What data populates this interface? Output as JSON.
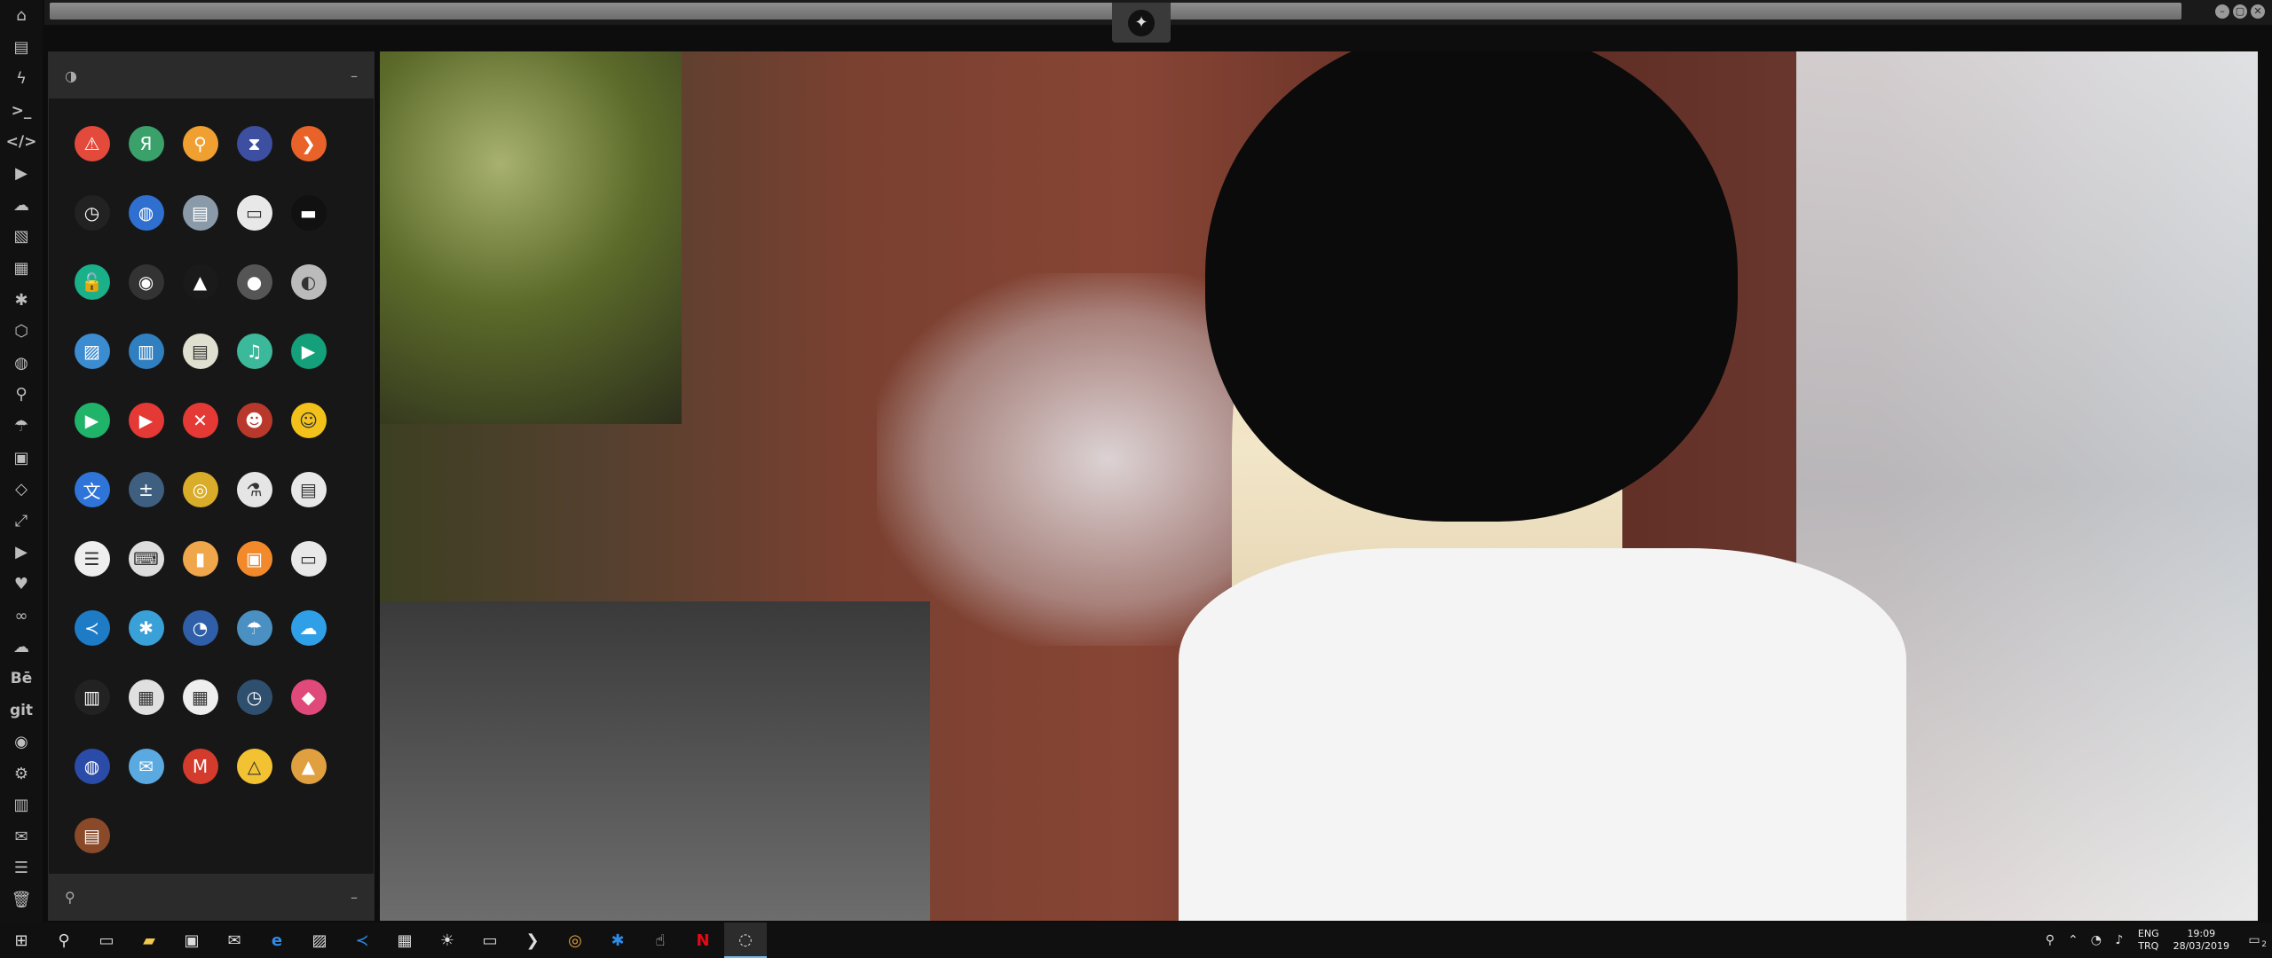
{
  "leftbar": {
    "icons": [
      "home-icon",
      "document-icon",
      "lightning-icon",
      "terminal-icon",
      "code-icon",
      "play-icon",
      "cloud-icon",
      "image-icon",
      "newspaper-icon",
      "gear-icon",
      "hexagon-icon",
      "globe-icon",
      "search-icon",
      "umbrella-icon",
      "contact-icon",
      "tag-icon",
      "expand-icon",
      "youtube-icon",
      "heart-icon",
      "link-icon",
      "cloud-upload-icon",
      "behance-icon",
      "git-icon",
      "github-icon",
      "bicycle-icon",
      "map-icon",
      "mail-icon",
      "list-icon",
      "trash-icon"
    ],
    "glyphs": [
      "⌂",
      "▤",
      "ϟ",
      ">_",
      "</>",
      "▶",
      "☁",
      "▧",
      "▦",
      "✱",
      "⬡",
      "◍",
      "⚲",
      "☂",
      "▣",
      "◇",
      "⤢",
      "▶",
      "♥",
      "∞",
      "☁",
      "Bē",
      "git",
      "◉",
      "⚙",
      "▥",
      "✉",
      "☰",
      "🗑"
    ]
  },
  "topbar": {
    "logo_glyph": "✦",
    "controls": [
      "–",
      "▢",
      "✕"
    ]
  },
  "panel": {
    "header_left_icon": "◑",
    "header_right_icon": "–",
    "footer_left_icon": "⚲",
    "footer_right_icon": "–",
    "apps": [
      {
        "name": "warning-app-icon",
        "glyph": "⚠",
        "color": "#e34a3b"
      },
      {
        "name": "yandex-app-icon",
        "glyph": "Я",
        "color": "#3aa16a"
      },
      {
        "name": "search-app-icon",
        "glyph": "⚲",
        "color": "#f0a030"
      },
      {
        "name": "hourglass-app-icon",
        "glyph": "⧗",
        "color": "#3c4fa0"
      },
      {
        "name": "arrow-app-icon",
        "glyph": "❯",
        "color": "#e8622a"
      },
      {
        "name": "clock-app-icon",
        "glyph": "◷",
        "color": "#222222"
      },
      {
        "name": "globe-app-icon",
        "glyph": "◍",
        "color": "#2f6fd0"
      },
      {
        "name": "server-app-icon",
        "glyph": "▤",
        "color": "#8a9aa8"
      },
      {
        "name": "window-app-icon",
        "glyph": "▭",
        "color": "#e8e8e8"
      },
      {
        "name": "hat-app-icon",
        "glyph": "▬",
        "color": "#111111"
      },
      {
        "name": "unlock-app-icon",
        "glyph": "🔓",
        "color": "#1ab08a"
      },
      {
        "name": "github-app-icon",
        "glyph": "◉",
        "color": "#333333"
      },
      {
        "name": "startrek-app-icon",
        "glyph": "▲",
        "color": "#1a1a1a"
      },
      {
        "name": "deathstar-app-icon",
        "glyph": "●",
        "color": "#555555"
      },
      {
        "name": "moon-app-icon",
        "glyph": "◐",
        "color": "#bbbbbb"
      },
      {
        "name": "photos-app-icon",
        "glyph": "▨",
        "color": "#3b8cd0"
      },
      {
        "name": "books-app-icon",
        "glyph": "▥",
        "color": "#2f7fc1"
      },
      {
        "name": "notes-app-icon",
        "glyph": "▤",
        "color": "#e0e0d0"
      },
      {
        "name": "music-app-icon",
        "glyph": "♫",
        "color": "#3cb89a"
      },
      {
        "name": "video-app-icon",
        "glyph": "▶",
        "color": "#13a07a"
      },
      {
        "name": "play-store-app-icon",
        "glyph": "▶",
        "color": "#1fb46a"
      },
      {
        "name": "media-player-app-icon",
        "glyph": "▶",
        "color": "#e53935"
      },
      {
        "name": "close-app-icon",
        "glyph": "✕",
        "color": "#e53935"
      },
      {
        "name": "ironman-app-icon",
        "glyph": "☻",
        "color": "#b8392b"
      },
      {
        "name": "minion-app-icon",
        "glyph": "☺",
        "color": "#f2c21b"
      },
      {
        "name": "translate-app-icon",
        "glyph": "文",
        "color": "#2f74d9"
      },
      {
        "name": "calculator-app-icon",
        "glyph": "±",
        "color": "#3e5f80"
      },
      {
        "name": "chrome-app-icon",
        "glyph": "◎",
        "color": "#d9ad2a"
      },
      {
        "name": "lab-app-icon",
        "glyph": "⚗",
        "color": "#e5e5e5"
      },
      {
        "name": "document-app-icon",
        "glyph": "▤",
        "color": "#e8e8e8"
      },
      {
        "name": "text-editor-app-icon",
        "glyph": "☰",
        "color": "#eeeeee"
      },
      {
        "name": "keyboard-app-icon",
        "glyph": "⌨",
        "color": "#dddddd"
      },
      {
        "name": "file-app-icon",
        "glyph": "▮",
        "color": "#f0a64a"
      },
      {
        "name": "image-viewer-app-icon",
        "glyph": "▣",
        "color": "#f28a2b"
      },
      {
        "name": "presentation-app-icon",
        "glyph": "▭",
        "color": "#e8e8e8"
      },
      {
        "name": "vscode-app-icon",
        "glyph": "≺",
        "color": "#1e7cc7"
      },
      {
        "name": "network-app-icon",
        "glyph": "✱",
        "color": "#3aa0d8"
      },
      {
        "name": "installer-app-icon",
        "glyph": "◔",
        "color": "#2e5fa8"
      },
      {
        "name": "umbrella-app-icon",
        "glyph": "☂",
        "color": "#4a90c2"
      },
      {
        "name": "weather-app-icon",
        "glyph": "☁",
        "color": "#2fa0e8"
      },
      {
        "name": "equalizer-app-icon",
        "glyph": "▥",
        "color": "#222222"
      },
      {
        "name": "calendar-app-icon",
        "glyph": "▦",
        "color": "#e0e0e0"
      },
      {
        "name": "planner-app-icon",
        "glyph": "▦",
        "color": "#eeeeee"
      },
      {
        "name": "clock-face-app-icon",
        "glyph": "◷",
        "color": "#2f4f6f"
      },
      {
        "name": "color-picker-app-icon",
        "glyph": "◆",
        "color": "#e04a7a"
      },
      {
        "name": "earth-app-icon",
        "glyph": "◍",
        "color": "#2b4ba8"
      },
      {
        "name": "email-app-icon",
        "glyph": "✉",
        "color": "#5aa9e0"
      },
      {
        "name": "gmail-app-icon",
        "glyph": "M",
        "color": "#d33b2c"
      },
      {
        "name": "drive-app-icon",
        "glyph": "△",
        "color": "#f3c233"
      },
      {
        "name": "pyramid-app-icon",
        "glyph": "▲",
        "color": "#e0a040"
      },
      {
        "name": "radio-app-icon",
        "glyph": "▤",
        "color": "#8a4a2a"
      }
    ]
  },
  "taskbar": {
    "icons": [
      {
        "name": "start-button",
        "glyph": "⊞"
      },
      {
        "name": "search-button",
        "glyph": "⚲"
      },
      {
        "name": "task-view-button",
        "glyph": "▭"
      },
      {
        "name": "file-explorer-icon",
        "glyph": "▰"
      },
      {
        "name": "store-icon",
        "glyph": "▣"
      },
      {
        "name": "mail-icon",
        "glyph": "✉"
      },
      {
        "name": "edge-icon",
        "glyph": "e"
      },
      {
        "name": "image-app-icon",
        "glyph": "▨"
      },
      {
        "name": "vscode-icon",
        "glyph": "≺"
      },
      {
        "name": "news-icon",
        "glyph": "▦"
      },
      {
        "name": "brightness-icon",
        "glyph": "☀"
      },
      {
        "name": "terminal-icon",
        "glyph": "▭"
      },
      {
        "name": "powershell-icon",
        "glyph": "❯"
      },
      {
        "name": "chrome-icon",
        "glyph": "◎"
      },
      {
        "name": "remote-icon",
        "glyph": "✱"
      },
      {
        "name": "pointer-icon",
        "glyph": "☝"
      },
      {
        "name": "netflix-icon",
        "glyph": "N"
      },
      {
        "name": "active-app-icon",
        "glyph": "◌"
      }
    ],
    "language": [
      "ENG",
      "TRQ"
    ],
    "time": "19:09",
    "date": "28/03/2019",
    "notification_count": "2"
  }
}
